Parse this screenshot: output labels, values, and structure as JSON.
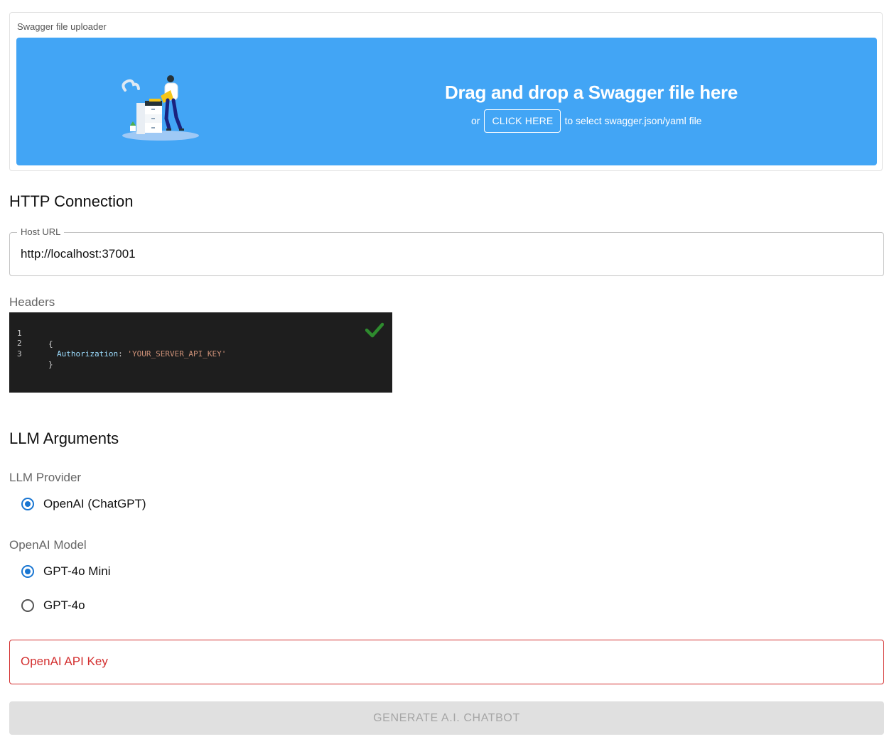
{
  "uploader": {
    "caption": "Swagger file uploader",
    "title": "Drag and drop a Swagger file here",
    "or_text": "or",
    "click_label": "CLICK HERE",
    "after_text": "to select swagger.json/yaml file",
    "color": "#42a5f5"
  },
  "http": {
    "title": "HTTP Connection",
    "host_legend": "Host URL",
    "host_value": "http://localhost:37001",
    "headers_label": "Headers",
    "editor": {
      "lines": [
        {
          "num": "1",
          "text": "{"
        },
        {
          "num": "2",
          "key": "Authorization",
          "sep": ": ",
          "value": "'YOUR_SERVER_API_KEY'"
        },
        {
          "num": "3",
          "text": "}"
        }
      ],
      "status_icon": "check-icon"
    }
  },
  "llm": {
    "title": "LLM Arguments",
    "provider_label": "LLM Provider",
    "provider_options": [
      {
        "label": "OpenAI (ChatGPT)",
        "checked": true
      }
    ],
    "model_label": "OpenAI Model",
    "model_options": [
      {
        "label": "GPT-4o Mini",
        "checked": true
      },
      {
        "label": "GPT-4o",
        "checked": false
      }
    ],
    "api_key_placeholder": "OpenAI API Key",
    "error_color": "#d32f2f",
    "accent_color": "#1976d2"
  },
  "generate_button": {
    "label": "GENERATE A.I. CHATBOT",
    "disabled": true
  }
}
